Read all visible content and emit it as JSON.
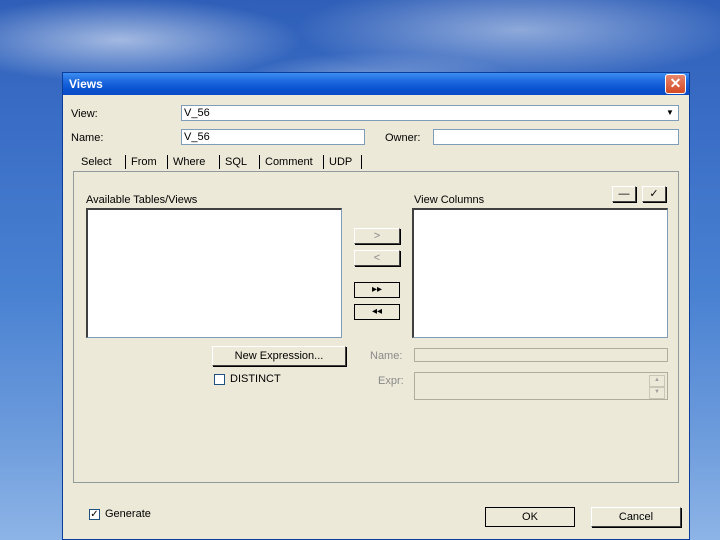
{
  "window": {
    "title": "Views",
    "close_glyph": "✕"
  },
  "form": {
    "view_label": "View:",
    "view_value": "V_56",
    "name_label": "Name:",
    "name_value": "V_56",
    "owner_label": "Owner:",
    "owner_value": ""
  },
  "tabs": [
    {
      "label": "Select",
      "active": true
    },
    {
      "label": "From"
    },
    {
      "label": "Where"
    },
    {
      "label": "SQL"
    },
    {
      "label": "Comment"
    },
    {
      "label": "UDP"
    }
  ],
  "select_tab": {
    "available_label": "Available Tables/Views",
    "columns_label": "View Columns",
    "move_up_glyph": "—",
    "move_down_glyph": "✓",
    "add_glyph": ">",
    "remove_glyph": "<",
    "add_all_glyph": "▸▸",
    "remove_all_glyph": "◂◂",
    "new_expression_label": "New Expression...",
    "distinct_label": "DISTINCT",
    "name_label": "Name:",
    "expr_label": "Expr:"
  },
  "footer": {
    "generate_label": "Generate",
    "generate_checked": true,
    "check_glyph": "✓",
    "ok_label": "OK",
    "cancel_label": "Cancel"
  }
}
